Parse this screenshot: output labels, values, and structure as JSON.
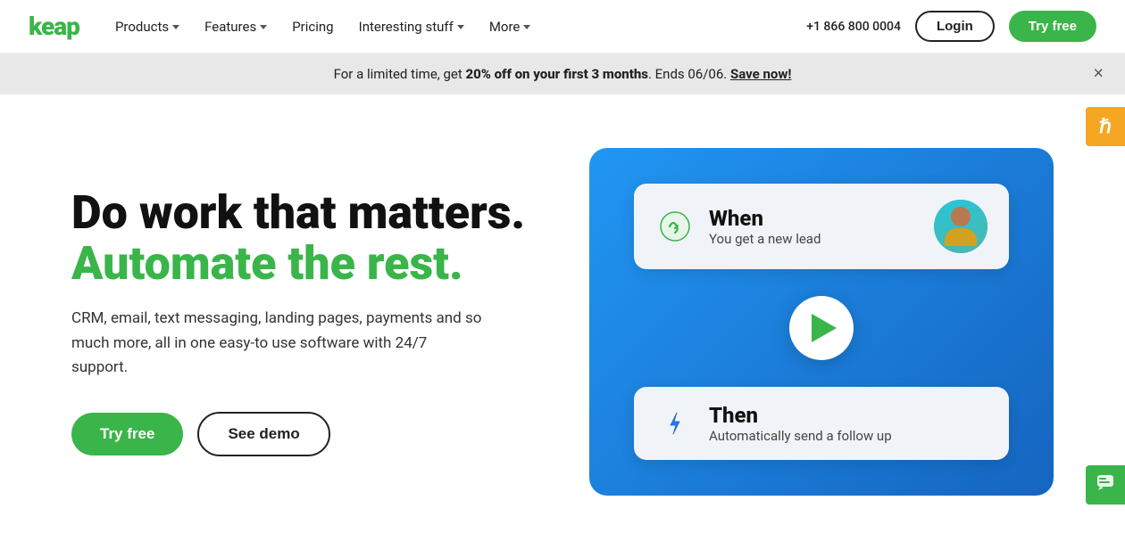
{
  "nav": {
    "logo": "keap",
    "links": [
      {
        "label": "Products",
        "has_dropdown": true
      },
      {
        "label": "Features",
        "has_dropdown": true
      },
      {
        "label": "Pricing",
        "has_dropdown": false
      },
      {
        "label": "Interesting stuff",
        "has_dropdown": true
      },
      {
        "label": "More",
        "has_dropdown": true
      }
    ],
    "phone": "+1 866 800 0004",
    "login_label": "Login",
    "try_free_label": "Try free"
  },
  "banner": {
    "text_prefix": "For a limited time, get ",
    "highlight": "20% off on your first 3 months",
    "text_suffix": ". Ends 06/06. ",
    "cta": "Save now!",
    "close_label": "×"
  },
  "hero": {
    "heading_black": "Do work that matters.",
    "heading_green": "Automate the rest.",
    "subtext": "CRM, email, text messaging, landing pages, payments and so much more, all in one easy-to use software with 24/7 support.",
    "try_free_label": "Try free",
    "see_demo_label": "See demo"
  },
  "illustration": {
    "when_card": {
      "title": "When",
      "subtitle": "You get a new lead"
    },
    "then_card": {
      "title": "Then",
      "subtitle": "Automatically send a follow up"
    }
  },
  "floats": {
    "h_icon": "ℏ",
    "chat_icon": "💬"
  },
  "colors": {
    "green": "#3ab549",
    "blue": "#2196f3",
    "dark_blue": "#1565c0",
    "orange": "#f5a623"
  }
}
